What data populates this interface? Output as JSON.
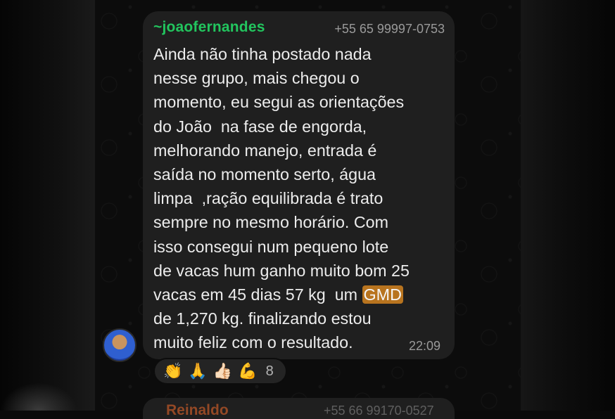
{
  "message": {
    "sender": "~joaofernandes",
    "phone": "+55 65 99997-0753",
    "lines": [
      "Ainda não tinha postado nada",
      "nesse grupo, mais chegou o",
      "momento, eu segui as orientações",
      "do João  na fase de engorda,",
      "melhorando manejo, entrada é",
      "saída no momento serto, água",
      "limpa  ,ração equilibrada é trato",
      "sempre no mesmo horário. Com",
      "isso consegui num pequeno lote",
      "de vacas hum ganho muito bom 25",
      "vacas em 45 dias 57 kg  um ",
      "de 1,270 kg. finalizando estou",
      "muito feliz com o resultado."
    ],
    "highlight": "GMD",
    "time": "22:09"
  },
  "reactions": {
    "emojis": [
      "👏",
      "🙏",
      "👍🏻",
      "💪"
    ],
    "count": "8"
  },
  "next_message": {
    "sender": "Reinaldo",
    "phone": "+55 66 99170-0527"
  },
  "colors": {
    "sender": "#22c55e",
    "bubble": "#1f1f1f",
    "highlight": "#b8741f",
    "next_sender": "#e0642a"
  }
}
